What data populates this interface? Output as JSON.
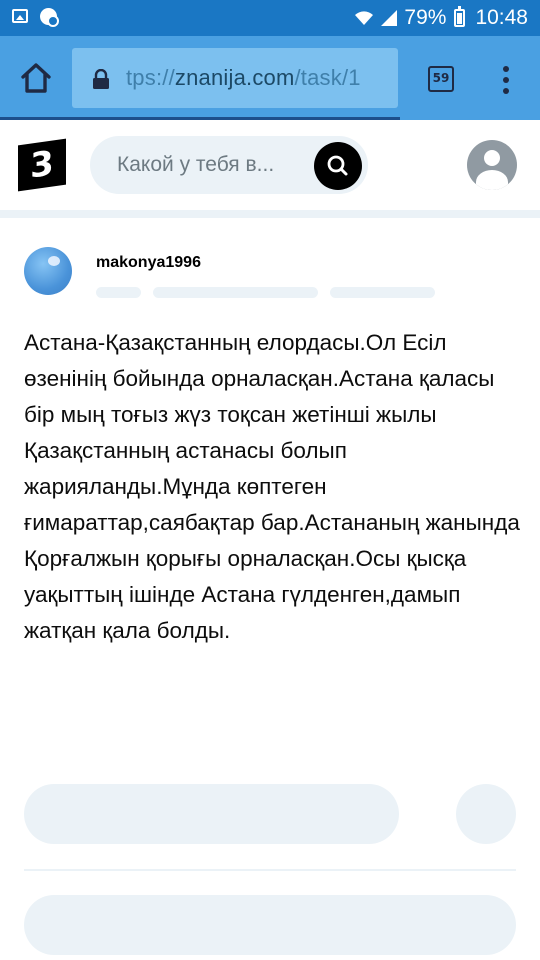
{
  "status_bar": {
    "battery": "79%",
    "time": "10:48",
    "icons": [
      "gallery-icon",
      "settings-notification-icon",
      "wifi-icon",
      "signal-icon",
      "battery-icon"
    ]
  },
  "browser": {
    "url_prefix": "tps://",
    "url_host": "znanija.com",
    "url_path": "/task/1",
    "tab_count": "59",
    "colors": {
      "toolbar": "#4aa0e2",
      "url_box": "#7cc0ef",
      "status": "#1a77c4"
    }
  },
  "site": {
    "logo_text": "3",
    "search_placeholder": "Какой у тебя в...",
    "colors": {
      "pill": "#ebf2f7",
      "accent": "#000000"
    }
  },
  "answer": {
    "username": "makonya1996",
    "text": "Астана-Қазақстанның елордасы.Ол Есіл өзенінің бойында орналасқан.Астана қаласы бір мың тоғыз жүз тоқсан жетінші жылы Қазақстанның астанасы болып жарияланды.Мұнда көптеген ғимараттар,саябақтар бар.Астананың жанында Қорғалжын қорығы орналасқан.Осы қысқа уақыттың ішінде Астана гүлденген,дамып жатқан қала болды."
  }
}
